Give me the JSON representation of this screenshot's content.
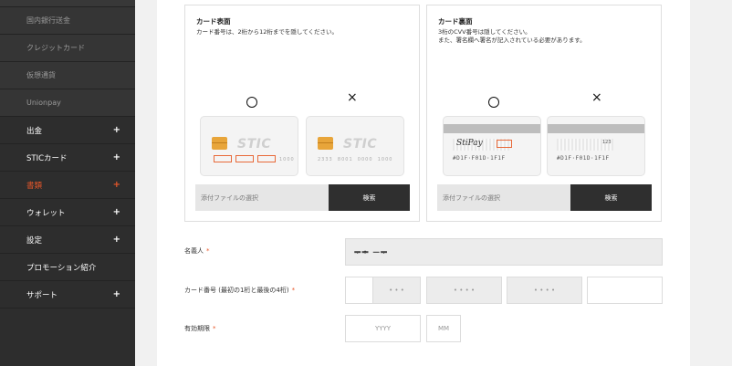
{
  "sidebar": {
    "items": [
      {
        "label": "国内銀行送金",
        "type": "sub",
        "plus": ""
      },
      {
        "label": "クレジットカード",
        "type": "sub",
        "plus": ""
      },
      {
        "label": "仮想通貨",
        "type": "sub",
        "plus": ""
      },
      {
        "label": "Unionpay",
        "type": "sub",
        "plus": ""
      },
      {
        "label": "出金",
        "type": "main",
        "plus": "+"
      },
      {
        "label": "STICカード",
        "type": "main",
        "plus": "+"
      },
      {
        "label": "書類",
        "type": "main active",
        "plus": "+"
      },
      {
        "label": "ウォレット",
        "type": "main",
        "plus": "+"
      },
      {
        "label": "設定",
        "type": "main",
        "plus": "+"
      },
      {
        "label": "プロモーション紹介",
        "type": "main",
        "plus": ""
      },
      {
        "label": "サポート",
        "type": "main",
        "plus": "+"
      }
    ],
    "colors": {
      "bg": "#2d2d2d",
      "active": "#e8572a"
    }
  },
  "front": {
    "title": "カード表面",
    "desc": "カード番号は、2桁から12桁までを隠してください。",
    "ok_mark": "○",
    "ng_mark": "×",
    "brand": "STIC",
    "card_num_text": "1000",
    "upload_placeholder": "添付ファイルの選択",
    "upload_button": "検索"
  },
  "back": {
    "title": "カード裏面",
    "desc_line1": "3桁のCVV番号は隠してください。",
    "desc_line2": "また、署名欄へ署名が記入されている必要があります。",
    "ok_mark": "○",
    "ng_mark": "×",
    "signature": "StiPay",
    "cvv": "123",
    "back_number": "#D1F·F01D·1F1F",
    "upload_placeholder": "添付ファイルの選択",
    "upload_button": "検索"
  },
  "form": {
    "name_label": "名義人",
    "name_value": "ᆕᆃ ᅳᆕ",
    "card_label": "カード番号 (最初の1桁と最後の4桁)",
    "card_masks": [
      "• • •",
      "• • • •",
      "• • • •"
    ],
    "expiry_label": "有効期限",
    "year_placeholder": "YYYY",
    "month_placeholder": "MM",
    "required_mark": "*"
  }
}
